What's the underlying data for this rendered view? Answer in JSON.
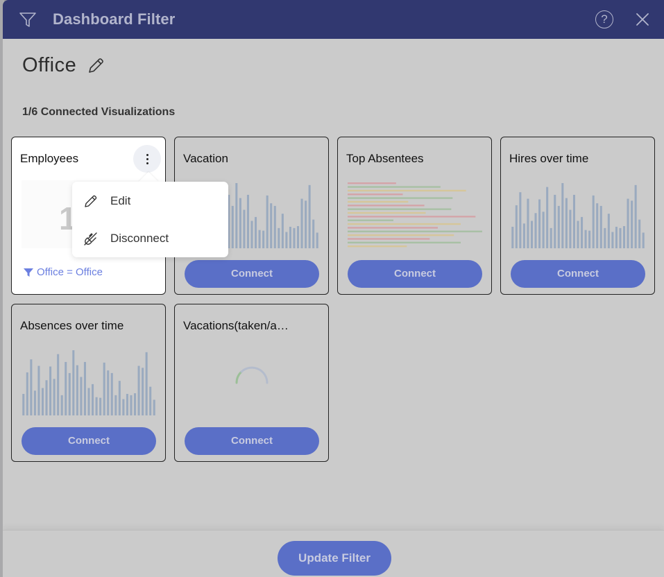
{
  "header": {
    "title": "Dashboard Filter",
    "filter_icon": "funnel-icon",
    "help_icon": "help-icon",
    "help_glyph": "?",
    "close_icon": "close-icon"
  },
  "filter": {
    "name": "Office",
    "edit_icon": "pencil-icon",
    "connected_summary": "1/6 Connected Visualizations"
  },
  "colors": {
    "header_bg": "#313870",
    "accent_button": "#5a6fc7",
    "filter_chip": "#6b7fe0",
    "bar_color": "#9aaabf",
    "red_line": "#d4a4a8",
    "green_line": "#a8c0a4",
    "yellow_line": "#d6c69a"
  },
  "cards": [
    {
      "title": "Employees",
      "connected": true,
      "big_number": "1",
      "filter_chip": "Office = Office",
      "menu": {
        "items": [
          {
            "label": "Edit",
            "icon": "pencil-icon"
          },
          {
            "label": "Disconnect",
            "icon": "unplug-icon"
          }
        ]
      }
    },
    {
      "title": "Vacation",
      "connected": false,
      "preview": "bars",
      "button": "Connect"
    },
    {
      "title": "Top Absentees",
      "connected": false,
      "preview": "hbars",
      "button": "Connect"
    },
    {
      "title": "Hires over time",
      "connected": false,
      "preview": "bars",
      "button": "Connect"
    },
    {
      "title": "Absences over time",
      "connected": false,
      "preview": "bars",
      "button": "Connect"
    },
    {
      "title": "Vacations(taken/a…",
      "connected": false,
      "preview": "loading",
      "button": "Connect"
    }
  ],
  "preview_bars": [
    0.33,
    0.66,
    0.86,
    0.38,
    0.76,
    0.42,
    0.54,
    0.75,
    0.56,
    0.94,
    0.31,
    0.82,
    0.65,
    1.0,
    0.77,
    0.59,
    0.82,
    0.42,
    0.48,
    0.28,
    0.27,
    0.81,
    0.69,
    0.65,
    0.31,
    0.53,
    0.25,
    0.33,
    0.31,
    0.34,
    0.76,
    0.73,
    0.97,
    0.44,
    0.24
  ],
  "preview_hbars": [
    {
      "value": 0.36,
      "color": "red"
    },
    {
      "value": 0.69,
      "color": "green"
    },
    {
      "value": 0.88,
      "color": "yellow"
    },
    {
      "value": 0.41,
      "color": "red"
    },
    {
      "value": 0.78,
      "color": "green"
    },
    {
      "value": 0.45,
      "color": "yellow"
    },
    {
      "value": 0.57,
      "color": "red"
    },
    {
      "value": 0.77,
      "color": "green"
    },
    {
      "value": 0.58,
      "color": "yellow"
    },
    {
      "value": 0.95,
      "color": "red"
    },
    {
      "value": 0.34,
      "color": "green"
    },
    {
      "value": 0.84,
      "color": "yellow"
    },
    {
      "value": 0.67,
      "color": "red"
    },
    {
      "value": 1.0,
      "color": "green"
    },
    {
      "value": 0.79,
      "color": "yellow"
    },
    {
      "value": 0.61,
      "color": "red"
    },
    {
      "value": 0.84,
      "color": "green"
    },
    {
      "value": 0.44,
      "color": "yellow"
    }
  ],
  "footer": {
    "update_button": "Update Filter"
  }
}
